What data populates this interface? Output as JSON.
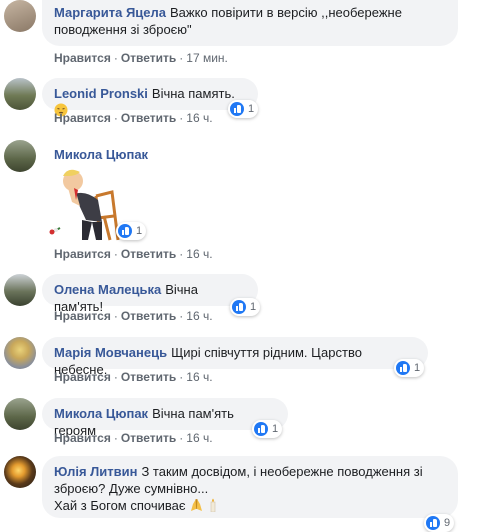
{
  "colors": {
    "author": "#385898",
    "bubble": "#f2f3f5",
    "meta": "#606770",
    "like": "#2078f4"
  },
  "actions": {
    "like": "Нравится",
    "reply": "Ответить",
    "separator": "·"
  },
  "comments": [
    {
      "author": "Маргарита Яцела",
      "text_line1": "Важко повірити в версію ,,необережне",
      "text_line2": "поводження зі зброєю\"",
      "time": "17 мин."
    },
    {
      "author": "Leonid Pronski",
      "text": "Вічна память.",
      "emoji": "pensive-face",
      "reactions": "1",
      "time": "16 ч."
    },
    {
      "author": "Микола Цюпак",
      "sticker": "sad-man-on-chair-sticker",
      "reactions": "1",
      "time": "16 ч."
    },
    {
      "author": "Олена Малецька",
      "text": "Вічна пам'ять!",
      "reactions": "1",
      "time": "16 ч."
    },
    {
      "author": "Марія Мовчанець",
      "text": "Щирі співчуття рідним. Царство небесне.",
      "reactions": "1",
      "time": "16 ч."
    },
    {
      "author": "Микола Цюпак",
      "text": "Вічна пам'ять героям",
      "reactions": "1",
      "time": "16 ч."
    },
    {
      "author": "Юлія Литвин",
      "text_line1": "З таким досвідом, і необережне поводження зі",
      "text_line2": "зброєю? Дуже сумнівно...",
      "text_line3": "Хай з Богом спочиває",
      "emoji": [
        "praying-hands",
        "candle"
      ],
      "reactions": "9"
    }
  ]
}
